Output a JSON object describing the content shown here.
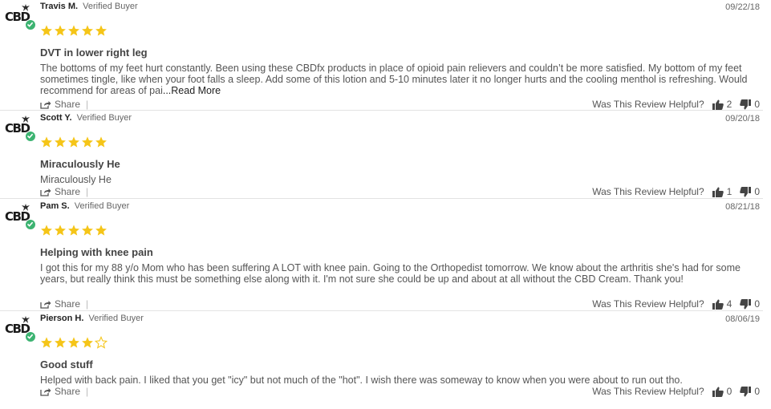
{
  "colors": {
    "star": "#f5c518",
    "star_empty_stroke": "#f5c518",
    "verified_badge": "#3cb371"
  },
  "icons": {
    "avatar": "cbd-logo-icon",
    "badge": "check-icon",
    "share": "share-icon",
    "up": "thumbs-up-icon",
    "down": "thumbs-down-icon",
    "star": "star-icon"
  },
  "reviews": [
    {
      "logo": "CBD",
      "name": "Travis M.",
      "verified": "Verified Buyer",
      "date": "09/22/18",
      "rating": 5,
      "title": "DVT in lower right leg",
      "body": "The bottoms of my feet hurt constantly. Been using these CBDfx products in place of opioid pain relievers and couldn’t be more satisfied. My bottom of my feet sometimes tingle, like when your foot falls a sleep. Add some of this lotion and 5-10 minutes later it no longer hurts and the cooling menthol is refreshing. Would recommend for areas of pai",
      "read_more": "...Read More",
      "share": "Share",
      "helpful_label": "Was This Review Helpful?",
      "up": "2",
      "down": "0"
    },
    {
      "logo": "CBD",
      "name": "Scott Y.",
      "verified": "Verified Buyer",
      "date": "09/20/18",
      "rating": 5,
      "title": "Miraculously He",
      "body": "Miraculously He",
      "read_more": "",
      "share": "Share",
      "helpful_label": "Was This Review Helpful?",
      "up": "1",
      "down": "0"
    },
    {
      "logo": "CBD",
      "name": "Pam S.",
      "verified": "Verified Buyer",
      "date": "08/21/18",
      "rating": 5,
      "title": "Helping with knee pain",
      "body": "I got this for my 88 y/o Mom who has been suffering A LOT with knee pain. Going to the Orthopedist tomorrow. We know about the arthritis she's had for some years, but really think this must be something else along with it. I'm not sure she could be up and about at all without the CBD Cream. Thank you!",
      "read_more": "",
      "share": "Share",
      "helpful_label": "Was This Review Helpful?",
      "up": "4",
      "down": "0"
    },
    {
      "logo": "CBD",
      "name": "Pierson H.",
      "verified": "Verified Buyer",
      "date": "08/06/19",
      "rating": 4,
      "title": "Good stuff",
      "body": "Helped with back pain. I liked that you get \"icy\" but not much of the \"hot\". I wish there was someway to know when you were about to run out tho.",
      "read_more": "",
      "share": "Share",
      "helpful_label": "Was This Review Helpful?",
      "up": "0",
      "down": "0"
    }
  ]
}
